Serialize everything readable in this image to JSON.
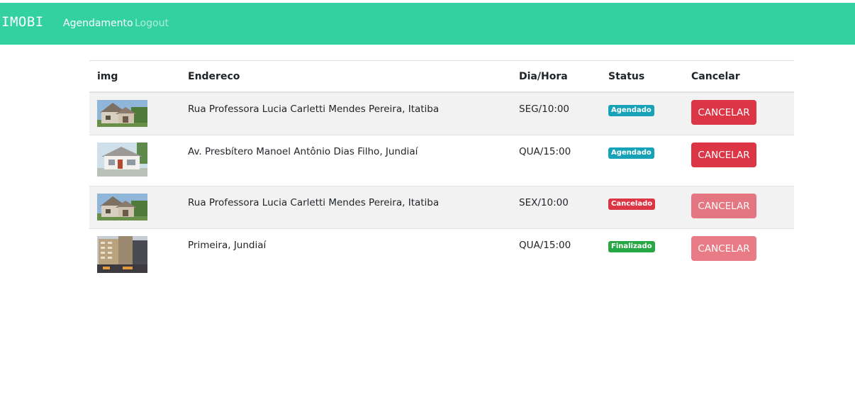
{
  "navbar": {
    "brand": "IMOBI",
    "links": [
      "Agendamento",
      "Logout"
    ],
    "color": "#32d19f"
  },
  "table": {
    "headers": [
      "img",
      "Endereco",
      "Dia/Hora",
      "Status",
      "Cancelar"
    ],
    "rows": [
      {
        "image": "house-beige-icon",
        "endereco": "Rua Professora Lucia Carletti Mendes Pereira, Itatiba",
        "dia_hora": "SEG/10:00",
        "status": "Agendado",
        "status_color": "#17a2b8",
        "cancel_label": "CANCELAR",
        "cancel_enabled": true
      },
      {
        "image": "house-white-icon",
        "endereco": "Av. Presbítero Manoel Antônio Dias Filho, Jundiaí",
        "dia_hora": "QUA/15:00",
        "status": "Agendado",
        "status_color": "#17a2b8",
        "cancel_label": "CANCELAR",
        "cancel_enabled": true
      },
      {
        "image": "house-beige-icon",
        "endereco": "Rua Professora Lucia Carletti Mendes Pereira, Itatiba",
        "dia_hora": "SEX/10:00",
        "status": "Cancelado",
        "status_color": "#dc3545",
        "cancel_label": "CANCELAR",
        "cancel_enabled": false
      },
      {
        "image": "apartment-building-icon",
        "endereco": "Primeira, Jundiaí",
        "dia_hora": "QUA/15:00",
        "status": "Finalizado",
        "status_color": "#28a745",
        "cancel_label": "CANCELAR",
        "cancel_enabled": false
      }
    ]
  }
}
